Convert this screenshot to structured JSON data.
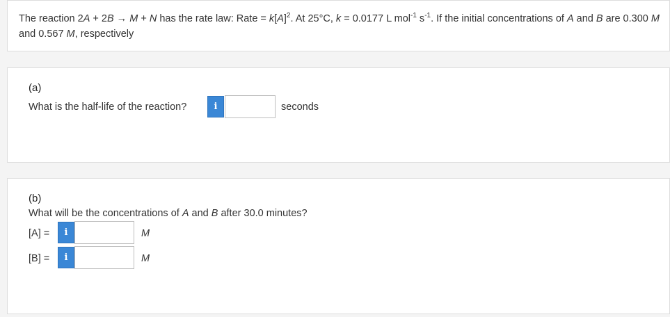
{
  "problem": {
    "s1": "The reaction 2",
    "s2": "A",
    "s3": " + 2",
    "s4": "B",
    "s5": " → ",
    "s6": "M",
    "s7": " + ",
    "s8": "N",
    "s9": " has the rate law: Rate = ",
    "s10": "k",
    "s11": "[",
    "s12": "A",
    "s13": "]",
    "s14": "2",
    "s15": ". At 25°C, ",
    "s16": "k",
    "s17": " = 0.0177 L mol",
    "s18": "-1",
    "s19": " s",
    "s20": "-1",
    "s21": ". If the initial concentrations of ",
    "s22": "A",
    "s23": " and ",
    "s24": "B",
    "s25": " are 0.300 ",
    "s26": "M",
    "s27": " and 0.567 ",
    "s28": "M",
    "s29": ", respectively"
  },
  "part_a": {
    "label": "(a)",
    "question": "What is the half-life of the reaction?",
    "info_icon": "i",
    "input_value": "",
    "unit": "seconds"
  },
  "part_b": {
    "label": "(b)",
    "q1": "What will be the concentrations of ",
    "q2": "A",
    "q3": " and ",
    "q4": "B",
    "q5": " after 30.0 minutes?",
    "rows": [
      {
        "label": "[A] =",
        "info_icon": "i",
        "input_value": "",
        "unit": "M"
      },
      {
        "label": "[B] =",
        "info_icon": "i",
        "input_value": "",
        "unit": "M"
      }
    ]
  },
  "colors": {
    "info_button": "#3a87d6",
    "card_border": "#dcdcdc",
    "page_bg": "#f4f4f4"
  }
}
